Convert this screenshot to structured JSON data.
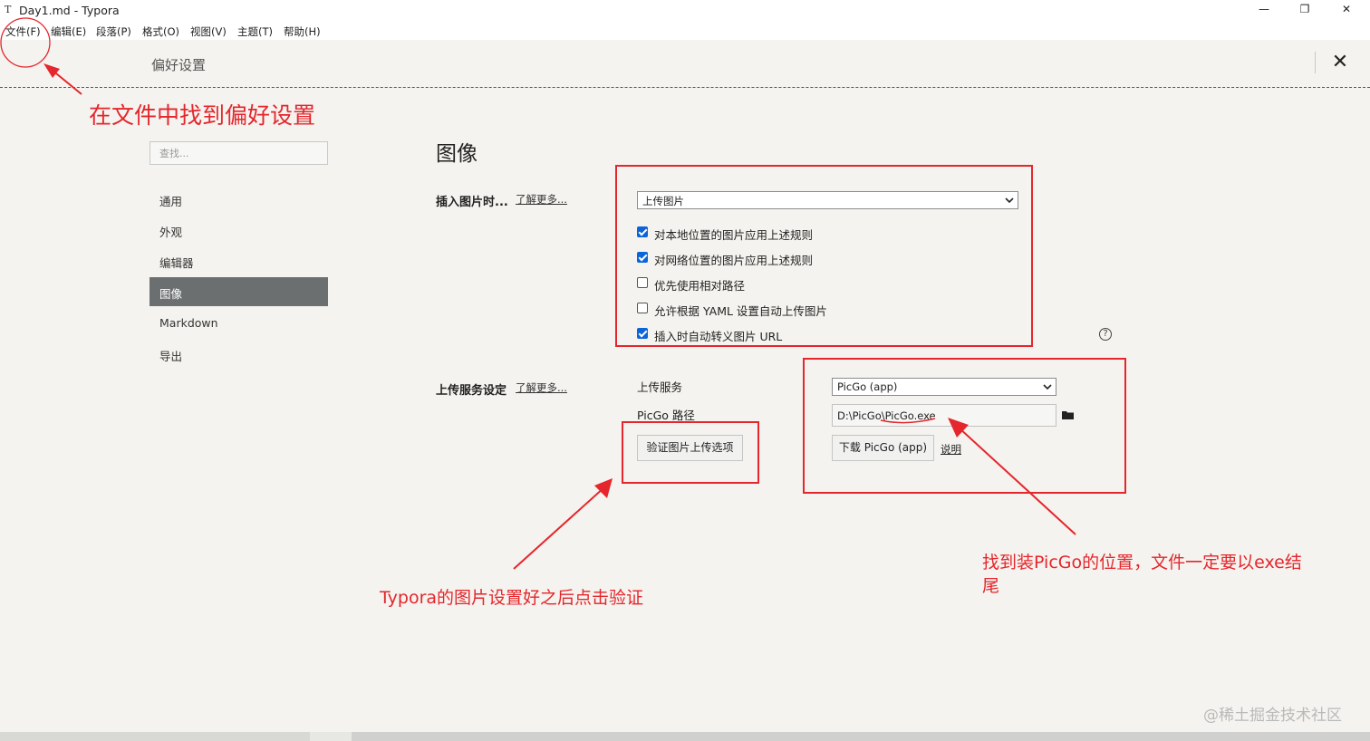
{
  "window": {
    "app_icon": "T",
    "title": "Day1.md - Typora",
    "minimize": "—",
    "maximize": "❐",
    "close": "✕"
  },
  "menubar": [
    {
      "label": "文件(F)"
    },
    {
      "label": "编辑(E)"
    },
    {
      "label": "段落(P)"
    },
    {
      "label": "格式(O)"
    },
    {
      "label": "视图(V)"
    },
    {
      "label": "主题(T)"
    },
    {
      "label": "帮助(H)"
    }
  ],
  "preferences": {
    "title": "偏好设置",
    "close": "✕",
    "search_placeholder": "查找...",
    "nav": [
      {
        "label": "通用"
      },
      {
        "label": "外观"
      },
      {
        "label": "编辑器"
      },
      {
        "label": "图像",
        "active": true
      },
      {
        "label": "Markdown"
      },
      {
        "label": "导出"
      }
    ]
  },
  "image_section": {
    "title": "图像",
    "insert_label": "插入图片时...",
    "learn_more": "了解更多...",
    "insert_action": "上传图片",
    "checkboxes": [
      {
        "label": "对本地位置的图片应用上述规则",
        "checked": true
      },
      {
        "label": "对网络位置的图片应用上述规则",
        "checked": true
      },
      {
        "label": "优先使用相对路径",
        "checked": false
      },
      {
        "label": "允许根据 YAML 设置自动上传图片",
        "checked": false
      },
      {
        "label": "插入时自动转义图片 URL",
        "checked": true
      }
    ],
    "help": "?",
    "upload_label": "上传服务设定",
    "upload_learn_more": "了解更多...",
    "upload_service_label": "上传服务",
    "upload_service_value": "PicGo (app)",
    "picgo_path_label": "PicGo 路径",
    "picgo_path_value": "D:\\PicGo\\PicGo.exe",
    "verify_button": "验证图片上传选项",
    "download_button": "下载 PicGo (app)",
    "explain_link": "说明"
  },
  "annotations": {
    "file_menu_note": "在文件中找到偏好设置",
    "verify_note": "Typora的图片设置好之后点击验证",
    "picgo_note_line1": "找到装PicGo的位置，文件一定要以exe结",
    "picgo_note_line2": "尾",
    "accent_color": "#e5262c"
  },
  "watermark": "@稀土掘金技术社区"
}
